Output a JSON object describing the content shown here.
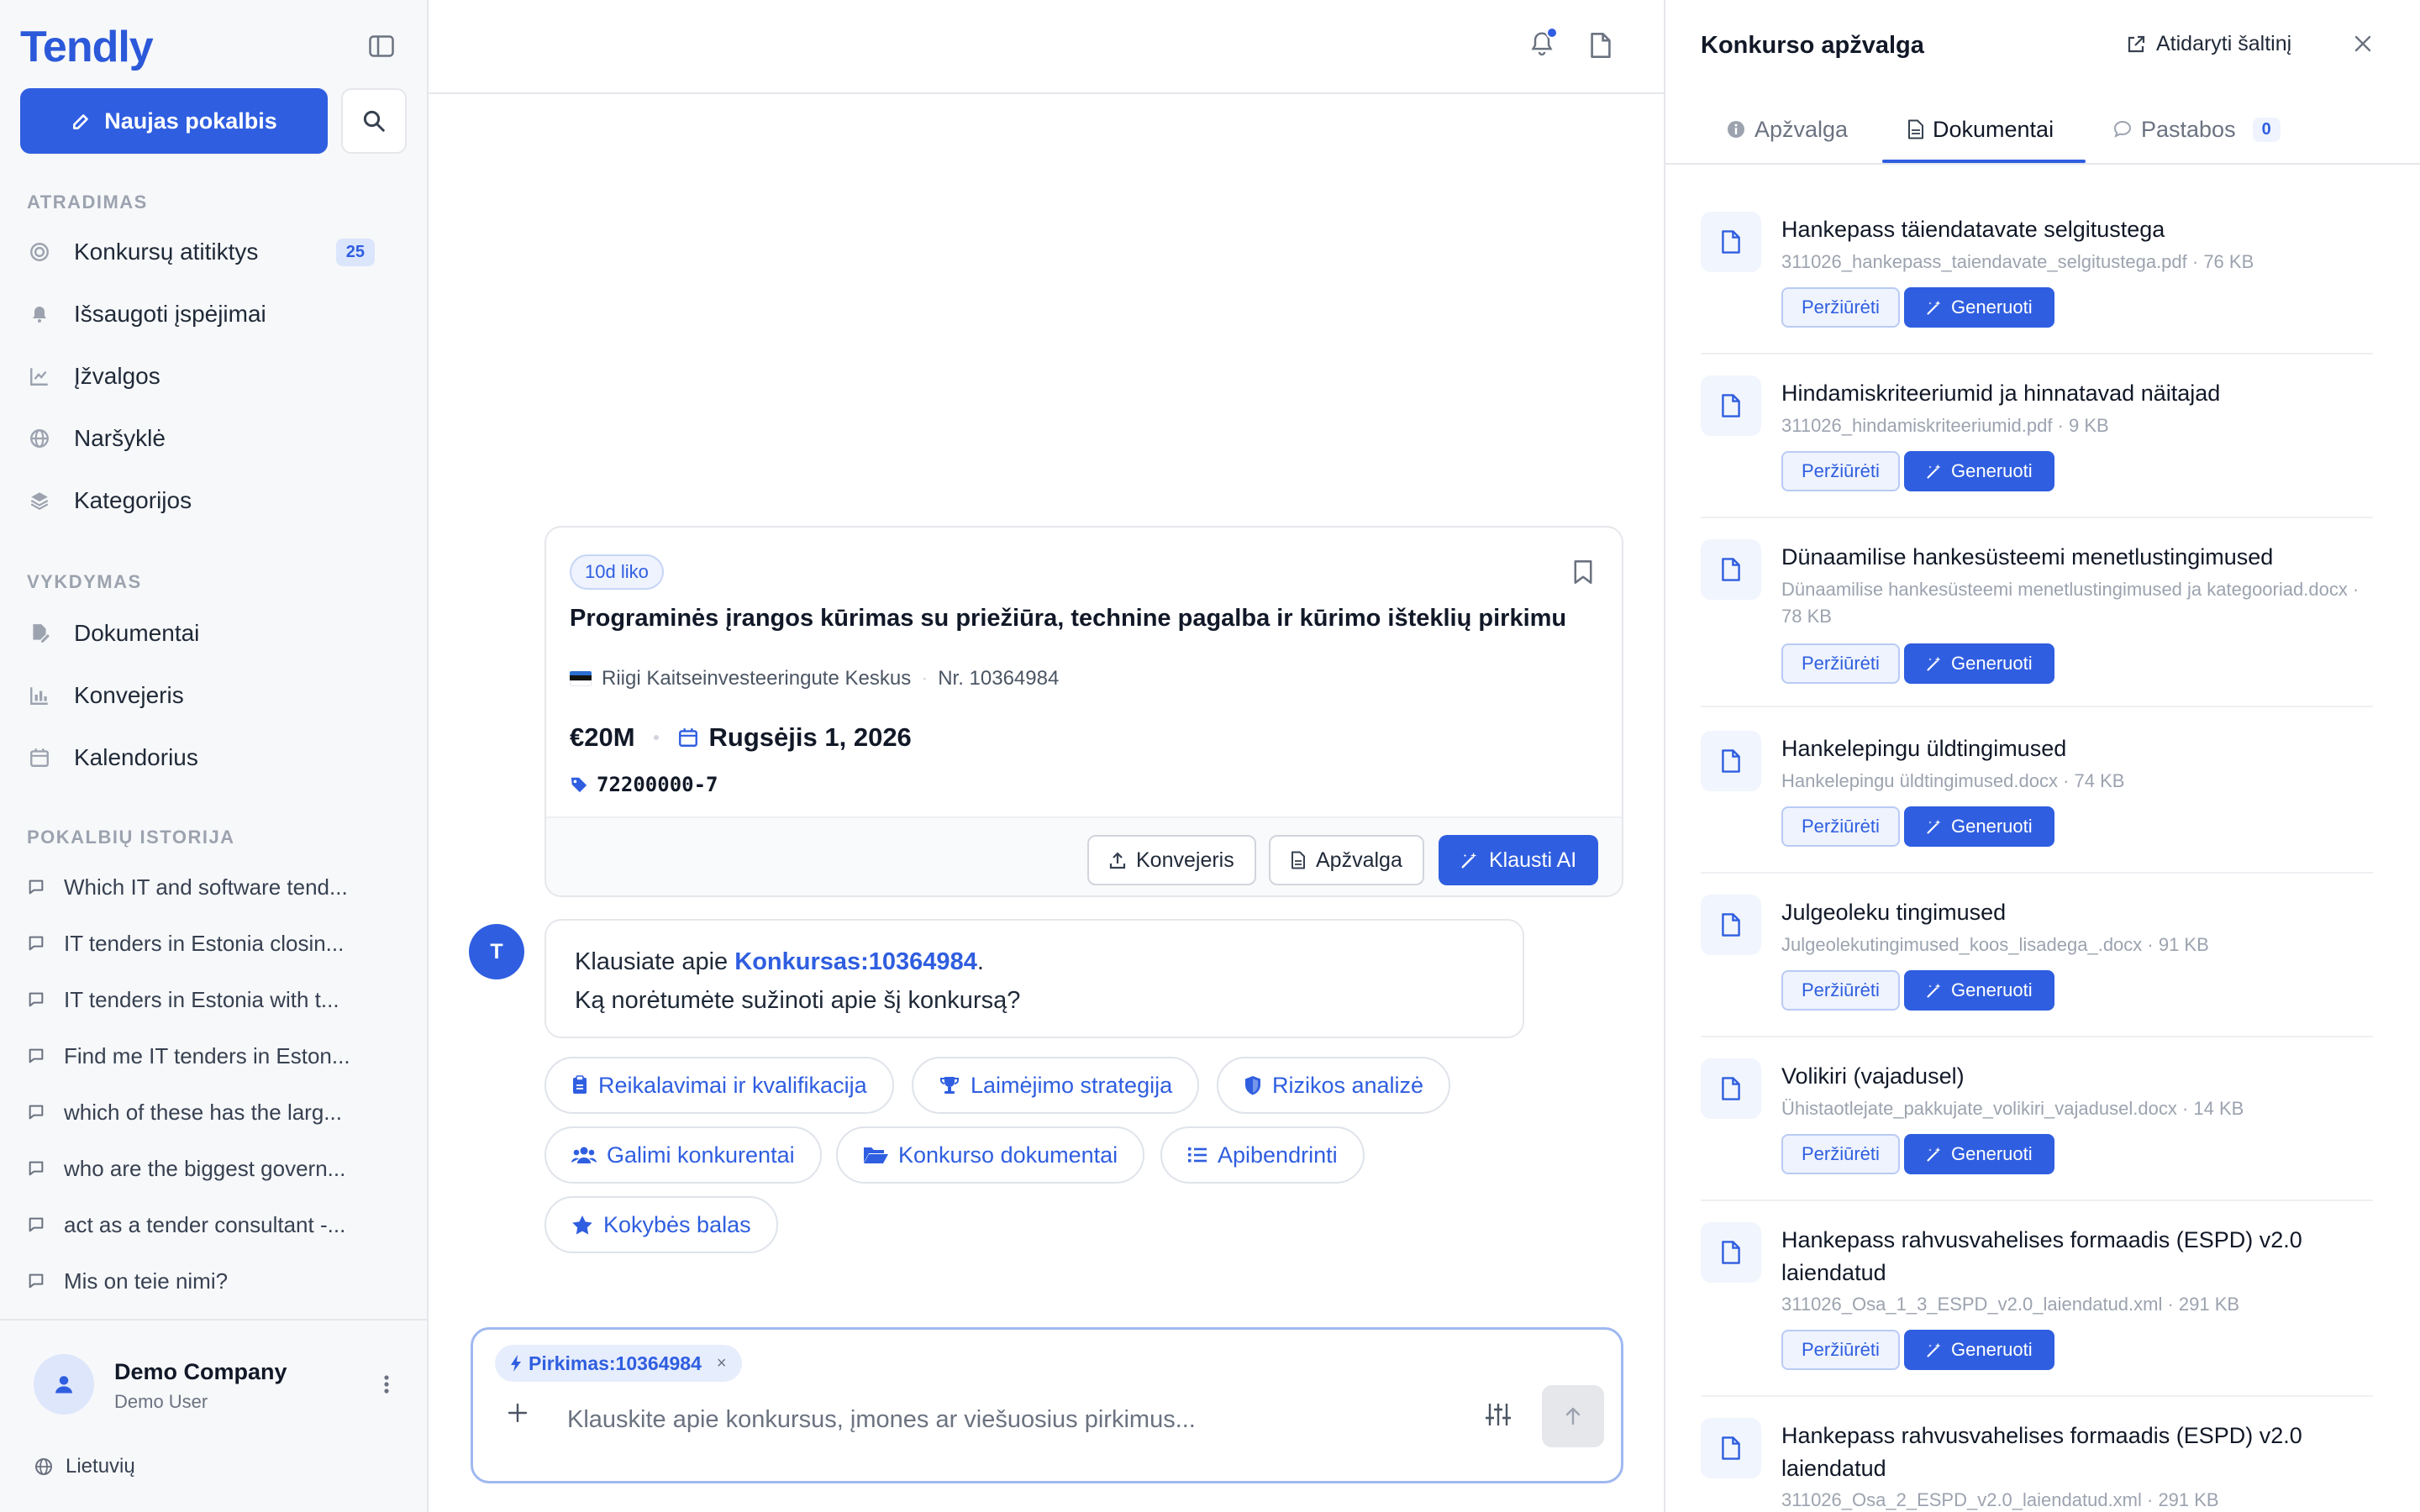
{
  "app": {
    "logo": "Tendly"
  },
  "sidebar": {
    "new_chat_label": "Naujas pokalbis",
    "sections": {
      "discovery": "ATRADIMAS",
      "execution": "VYKDYMAS",
      "history": "POKALBIŲ ISTORIJA"
    },
    "discovery_items": [
      {
        "label": "Konkursų atitiktys",
        "icon": "target-icon",
        "badge": "25"
      },
      {
        "label": "Išsaugoti įspėjimai",
        "icon": "bell-icon"
      },
      {
        "label": "Įžvalgos",
        "icon": "chart-line-icon"
      },
      {
        "label": "Naršyklė",
        "icon": "globe-icon"
      },
      {
        "label": "Kategorijos",
        "icon": "layers-icon"
      }
    ],
    "execution_items": [
      {
        "label": "Dokumentai",
        "icon": "document-edit-icon"
      },
      {
        "label": "Konvejeris",
        "icon": "bar-chart-icon"
      },
      {
        "label": "Kalendorius",
        "icon": "calendar-icon"
      }
    ],
    "history": [
      "Which IT and software tend...",
      "IT tenders in Estonia closin...",
      "IT tenders in Estonia with t...",
      "Find me IT tenders in Eston...",
      "which of these has the larg...",
      "who are the biggest govern...",
      "act as a tender consultant -...",
      "Mis on teie nimi?"
    ],
    "footer": {
      "company": "Demo Company",
      "user": "Demo User",
      "language": "Lietuvių"
    }
  },
  "tender_card": {
    "days_left": "10d liko",
    "title": "Programinės įrangos kūrimas su priežiūra, technine pagalba ir kūrimo išteklių pirkimu",
    "issuer": "Riigi Kaitseinvesteeringute Keskus",
    "number": "Nr. 10364984",
    "value": "€20M",
    "deadline": "Rugsėjis 1, 2026",
    "cpv": "72200000-7",
    "actions": {
      "pipeline": "Konvejeris",
      "overview": "Apžvalga",
      "ask_ai": "Klausti AI"
    }
  },
  "assistant": {
    "avatar_letter": "T",
    "message_prefix": "Klausiate apie ",
    "message_link": "Konkursas:10364984",
    "message_suffix": ".",
    "message_line2": "Ką norėtumėte sužinoti apie šį konkursą?"
  },
  "suggestions": [
    {
      "label": "Reikalavimai ir kvalifikacija",
      "icon": "clipboard-icon"
    },
    {
      "label": "Laimėjimo strategija",
      "icon": "trophy-icon"
    },
    {
      "label": "Rizikos analizė",
      "icon": "shield-icon"
    },
    {
      "label": "Galimi konkurentai",
      "icon": "users-icon"
    },
    {
      "label": "Konkurso dokumentai",
      "icon": "folder-open-icon"
    },
    {
      "label": "Apibendrinti",
      "icon": "list-icon"
    },
    {
      "label": "Kokybės balas",
      "icon": "star-icon"
    }
  ],
  "composer": {
    "context_tag": "Pirkimas:10364984",
    "placeholder": "Klauskite apie konkursus, įmones ar viešuosius pirkimus...",
    "value": ""
  },
  "panel": {
    "title": "Konkurso apžvalga",
    "open_source": "Atidaryti šaltinį",
    "tabs": [
      {
        "label": "Apžvalga",
        "icon": "info-icon"
      },
      {
        "label": "Dokumentai",
        "icon": "document-icon"
      },
      {
        "label": "Pastabos",
        "icon": "comment-icon",
        "count": "0"
      }
    ],
    "view_label": "Peržiūrėti",
    "generate_label": "Generuoti",
    "documents": [
      {
        "title": "Hankepass täiendatavate selgitustega",
        "meta": "311026_hankepass_taiendavate_selgitustega.pdf · 76 KB"
      },
      {
        "title": "Hindamiskriteeriumid ja hinnatavad näitajad",
        "meta": "311026_hindamiskriteeriumid.pdf · 9 KB"
      },
      {
        "title": "Dünaamilise hankesüsteemi menetlustingimused",
        "meta": "Dünaamilise hankesüsteemi menetlustingimused ja kategooriad.docx · 78 KB"
      },
      {
        "title": "Hankelepingu üldtingimused",
        "meta": "Hankelepingu üldtingimused.docx · 74 KB"
      },
      {
        "title": "Julgeoleku tingimused",
        "meta": "Julgeolekutingimused_koos_lisadega_.docx · 91 KB"
      },
      {
        "title": "Volikiri (vajadusel)",
        "meta": "Ühistaotlejate_pakkujate_volikiri_vajadusel.docx · 14 KB"
      },
      {
        "title": "Hankepass rahvusvahelises formaadis (ESPD) v2.0 laiendatud",
        "meta": "311026_Osa_1_3_ESPD_v2.0_laiendatud.xml · 291 KB"
      },
      {
        "title": "Hankepass rahvusvahelises formaadis (ESPD) v2.0 laiendatud",
        "meta": "311026_Osa_2_ESPD_v2.0_laiendatud.xml · 291 KB"
      }
    ]
  },
  "colors": {
    "accent": "#2f5ee0",
    "border": "#e5e7eb",
    "sidebar_bg": "#f7f8fa"
  }
}
